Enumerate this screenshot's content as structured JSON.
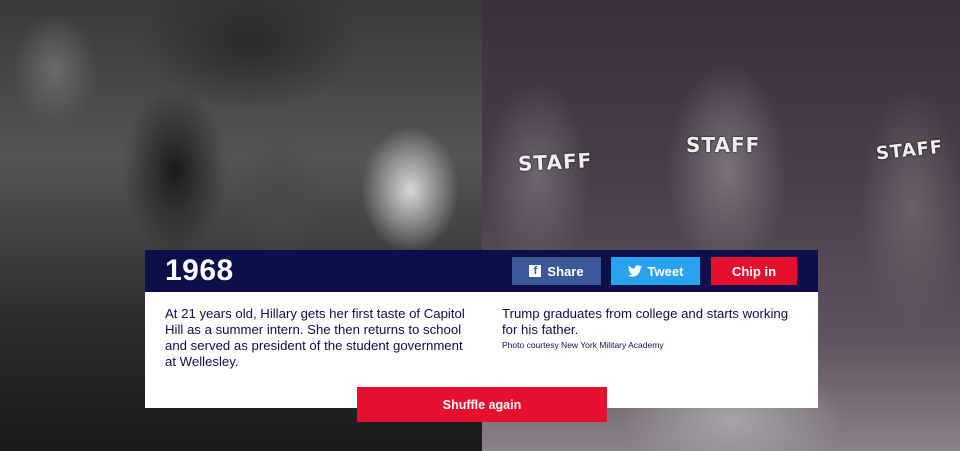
{
  "year": "1968",
  "buttons": {
    "share": "Share",
    "tweet": "Tweet",
    "chip_in": "Chip in",
    "shuffle": "Shuffle again"
  },
  "left": {
    "text": "At 21 years old, Hillary gets her first taste of Capitol Hill as a summer intern. She then returns to school and served as president of the student government at Wellesley."
  },
  "right": {
    "text": "Trump graduates from college and starts working for his father.",
    "photo_credit": "Photo courtesy New York Military Academy"
  },
  "photo_right": {
    "shirt_text": "STAFF"
  },
  "colors": {
    "navy": "#0b1148",
    "facebook": "#3b5998",
    "twitter": "#2aa3ef",
    "red": "#e4102e"
  },
  "icons": {
    "share": "facebook-icon",
    "tweet": "twitter-icon"
  }
}
